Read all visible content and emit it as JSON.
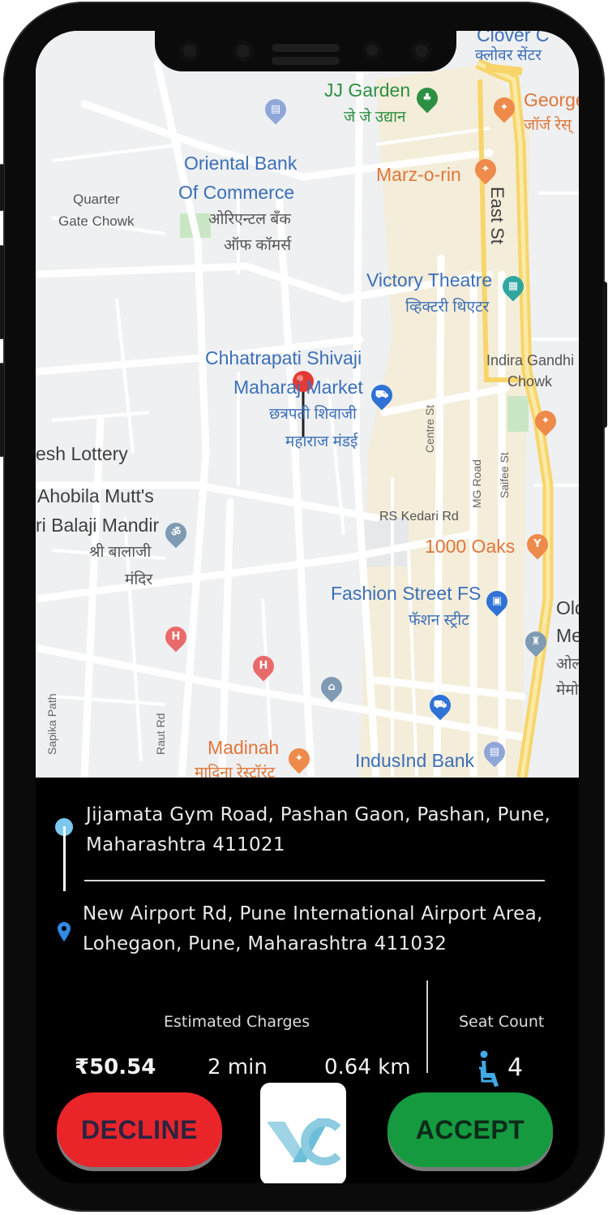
{
  "map": {
    "labels": {
      "clover_en": "Clover C",
      "clover_hi": "क्लोवर सेंटर",
      "jj_en": "JJ Garden",
      "jj_hi": "जे जे उद्यान",
      "george_en": "George",
      "george_hi": "जॉर्ज रेस्",
      "oriental_en1": "Oriental Bank",
      "oriental_en2": "Of Commerce",
      "oriental_hi1": "ओरिएन्टल बँक",
      "oriental_hi2": "ऑफ कॉमर्स",
      "marz": "Marz-o-rin",
      "quarter1": "Quarter",
      "quarter2": "Gate Chowk",
      "east_st": "East St",
      "victory_en": "Victory Theatre",
      "victory_hi": "व्हिक्टरी थिएटर",
      "chhatrapati_en1": "Chhatrapati Shivaji",
      "chhatrapati_en2": "Maharaj Market",
      "chhatrapati_hi1": "छत्रपती शिवाजी",
      "chhatrapati_hi2": "महाराज मंडई",
      "indira1": "Indira Gandhi",
      "indira2": "Chowk",
      "lottery": "esh Lottery",
      "ahobila": "Ahobila Mutt's",
      "balaji_en": "ri Balaji Mandir",
      "balaji_hi1": "श्री बालाजी",
      "balaji_hi2": "मंदिर",
      "centre_st": "Centre St",
      "mg_road": "MG Road",
      "saifee_st": "Saifee St",
      "rs_kedari": "RS Kedari Rd",
      "oaks": "1000 Oaks",
      "fashion_en": "Fashion Street FS",
      "fashion_hi": "फॅशन स्ट्रीट",
      "old1": "Old",
      "old2": "Me",
      "old3": "ओल",
      "old4": "मेमो",
      "sapika": "Sapika Path",
      "raut_rd": "Raut Rd",
      "madinah_en": "Madinah",
      "madinah_hi": "मादिना रेस्टॉरंट",
      "indusind": "IndusInd Bank"
    },
    "pin_icons": {
      "hospital_letter": "H",
      "om": "ॐ"
    }
  },
  "trip": {
    "pickup_address": "Jijamata Gym Road, Pashan Gaon, Pashan, Pune, Maharashtra 411021",
    "drop_address": "New Airport Rd, Pune International Airport Area, Lohegaon, Pune, Maharashtra 411032",
    "estimated_charges_label": "Estimated Charges",
    "price": "₹50.54",
    "duration": "2 min",
    "distance": "0.64 km",
    "seat_count_label": "Seat Count",
    "seat_count": "4"
  },
  "actions": {
    "decline_label": "DECLINE",
    "accept_label": "ACCEPT"
  },
  "colors": {
    "decline": "#e9252a",
    "accept": "#159a3f",
    "start_dot": "#7cc8ef",
    "end_pin": "#2f8be6",
    "seat_icon": "#41a9e6",
    "map_pin": "#e53935"
  },
  "icons": {
    "start": "pickup-dot-icon",
    "end": "drop-location-pin-icon",
    "seat": "accessible-seat-icon",
    "logo": "vc-app-logo-icon",
    "map_marker": "current-location-marker-icon"
  }
}
